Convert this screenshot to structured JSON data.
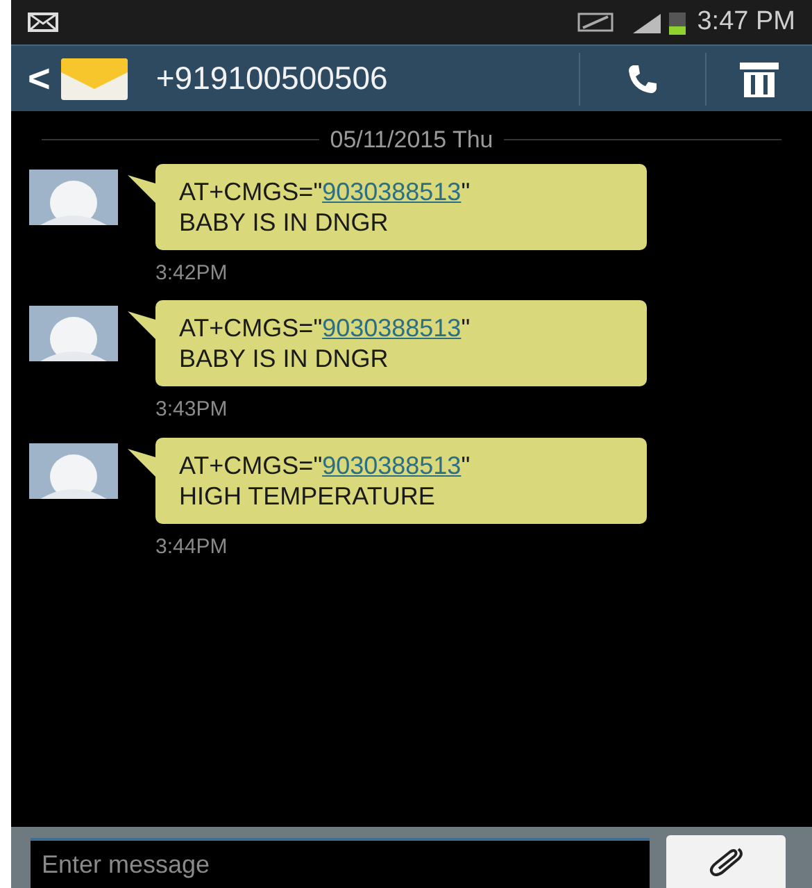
{
  "status_bar": {
    "time": "3:47 PM"
  },
  "header": {
    "back": "<",
    "contact": "+919100500506"
  },
  "date_divider": "05/11/2015 Thu",
  "messages": [
    {
      "prefix": "AT+CMGS=\"",
      "link": "9030388513",
      "suffix": "\"",
      "body": "BABY IS IN DNGR",
      "time": "3:42PM"
    },
    {
      "prefix": "AT+CMGS=\"",
      "link": "9030388513",
      "suffix": "\"",
      "body": "BABY IS IN DNGR",
      "time": "3:43PM"
    },
    {
      "prefix": "AT+CMGS=\"",
      "link": "9030388513",
      "suffix": "\"",
      "body": "HIGH TEMPERATURE",
      "time": "3:44PM"
    }
  ],
  "composer": {
    "placeholder": "Enter message"
  }
}
